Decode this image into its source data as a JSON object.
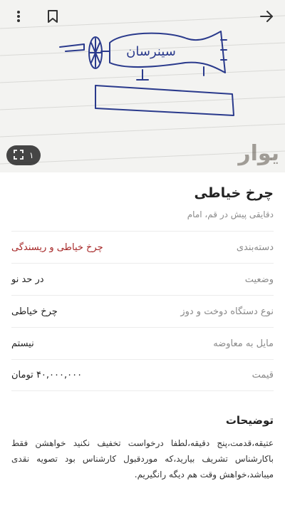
{
  "hero": {
    "image_label": "چرخ خیاطی sketch",
    "sketch_text": "سینرسان",
    "watermark": "یوار",
    "gallery_count": "۱"
  },
  "listing": {
    "title": "چرخ خیاطی",
    "subtitle": "دقایقی پیش در قم، امام"
  },
  "details": [
    {
      "label": "دسته‌بندی",
      "value": "چرخ خیاطی و ریسندگی"
    },
    {
      "label": "وضعیت",
      "value": "در حد نو"
    },
    {
      "label": "نوع دستگاه دوخت و دوز",
      "value": "چرخ خیاطی"
    },
    {
      "label": "مایل به معاوضه",
      "value": "نیستم"
    },
    {
      "label": "قیمت",
      "value": "۴۰,۰۰۰,۰۰۰ تومان"
    }
  ],
  "description": {
    "title": "توضیحات",
    "text": "عتیقه،قدمت،پنج دقیقه،لطفا درخواست تخفیف نکنید خواهشن فقط باکارشناس تشریف بیارید،که موردقبول کارشناس بود تصویه نقدی میباشد،خواهش وقت هم دیگه رانگیریم."
  },
  "colors": {
    "accent": "#a62626",
    "label": "#8a8a8a",
    "ink": "#2a3a8c"
  }
}
